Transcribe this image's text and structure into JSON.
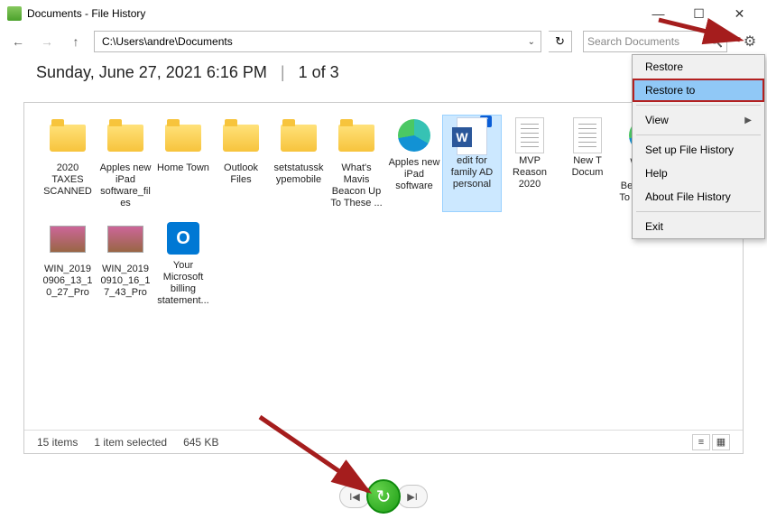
{
  "window": {
    "title": "Documents - File History"
  },
  "nav": {
    "path": "C:\\Users\\andre\\Documents",
    "search_placeholder": "Search Documents"
  },
  "snapshot": {
    "datetime": "Sunday, June 27, 2021 6:16 PM",
    "index": "1 of 3"
  },
  "items": [
    {
      "label": "2020 TAXES SCANNED",
      "type": "folder",
      "selected": false
    },
    {
      "label": "Apples new iPad software_fil es",
      "type": "folder",
      "selected": false
    },
    {
      "label": "Home Town",
      "type": "folder",
      "selected": false
    },
    {
      "label": "Outlook Files",
      "type": "folder",
      "selected": false
    },
    {
      "label": "setstatussk ypemobile",
      "type": "folder",
      "selected": false
    },
    {
      "label": "What's Mavis Beacon Up To These ...",
      "type": "folder",
      "selected": false
    },
    {
      "label": "Apples new iPad software",
      "type": "edge",
      "selected": false
    },
    {
      "label": "edit for family AD personal",
      "type": "word",
      "selected": true
    },
    {
      "label": "MVP Reason 2020",
      "type": "doc",
      "selected": false
    },
    {
      "label": "New T Docum",
      "type": "doc",
      "selected": false
    },
    {
      "label": "What's Mavis Beacon Up To These ...",
      "type": "edge",
      "selected": false
    },
    {
      "label": "WIN_2019 0906_13_1 0_27_Pro",
      "type": "thumb",
      "selected": false
    },
    {
      "label": "WIN_2019 0910_16_1 7_43_Pro",
      "type": "thumb",
      "selected": false
    },
    {
      "label": "Your Microsoft billing statement...",
      "type": "outlook",
      "selected": false
    }
  ],
  "status": {
    "count": "15 items",
    "selected": "1 item selected",
    "size": "645 KB"
  },
  "menu": {
    "restore": "Restore",
    "restore_to": "Restore to",
    "view": "View",
    "setup": "Set up File History",
    "help": "Help",
    "about": "About File History",
    "exit": "Exit"
  }
}
